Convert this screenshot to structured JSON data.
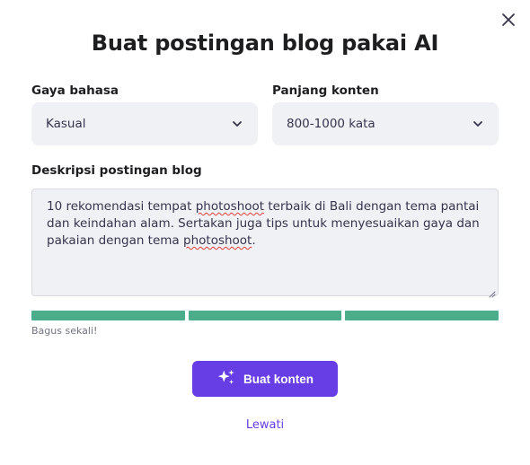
{
  "dialog": {
    "title": "Buat postingan blog pakai AI",
    "close_icon": "close-icon"
  },
  "style_field": {
    "label": "Gaya bahasa",
    "value": "Kasual",
    "icon": "chevron-down-icon"
  },
  "length_field": {
    "label": "Panjang konten",
    "value": "800-1000 kata",
    "icon": "chevron-down-icon"
  },
  "description_field": {
    "label": "Deskripsi postingan blog",
    "text_parts": [
      "10 rekomendasi tempat ",
      "photoshoot",
      " terbaik di Bali dengan tema pantai dan keindahan alam. Sertakan juga tips untuk menyesuaikan gaya dan pakaian dengan tema ",
      "photoshoot",
      "."
    ]
  },
  "strength": {
    "segments_filled": 3,
    "segments_total": 3,
    "color": "#4bad8a",
    "label": "Bagus sekali!"
  },
  "actions": {
    "primary_label": "Buat konten",
    "primary_icon": "sparkle-icon",
    "primary_color": "#673de6",
    "skip_label": "Lewati"
  }
}
